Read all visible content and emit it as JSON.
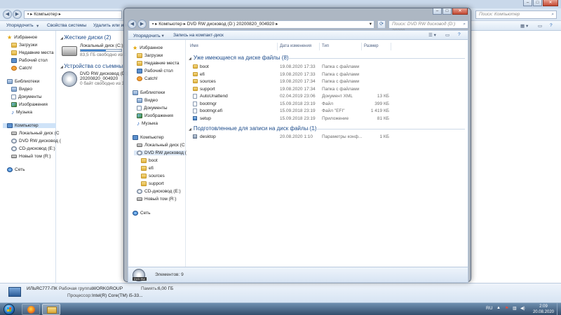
{
  "background_window": {
    "address": "Компьютер",
    "search_placeholder": "Поиск: Компьютер",
    "toolbar": {
      "organize": "Упорядочить",
      "system_properties": "Свойства системы",
      "uninstall": "Удалить или изм"
    },
    "nav": {
      "favorites": "Избранное",
      "downloads": "Загрузки",
      "recent_places": "Недавние места",
      "desktop": "Рабочий стол",
      "catch": "Catch!",
      "libraries": "Библиотеки",
      "video": "Видео",
      "documents": "Документы",
      "pictures": "Изображения",
      "music": "Музыка",
      "computer": "Компьютер",
      "local_disk_c": "Локальный диск (C",
      "dvd_rw": "DVD RW дисковод (",
      "cd_e": "CD-дисковод (E:)",
      "new_volume_r": "Новый том (R:)",
      "network": "Сеть"
    },
    "groups": {
      "hard_disks": "Жесткие диски (2)",
      "removable": "Устройства со съемны"
    },
    "drive_c": {
      "name": "Локальный диск (C:)",
      "free": "83,5 ГБ свободно из 2",
      "used_fraction": 0.62
    },
    "drive_d": {
      "name": "DVD RW дисковод (D:)",
      "label": "20200820_004920",
      "free": "0 байт свободно из 3"
    },
    "details": {
      "pc_name": "ИЛЬЯС777-ПК",
      "workgroup_label": "Рабочая группа:",
      "workgroup_value": "WORKGROUP",
      "memory_label": "Память:",
      "memory_value": "6,00 ГБ",
      "cpu_label": "Процессор:",
      "cpu_value": "Intel(R) Core(TM) i5-33..."
    }
  },
  "dialog": {
    "address_computer": "Компьютер",
    "address_drive": "DVD RW дисковод (D:) 20200820_004920",
    "search_placeholder": "Поиск: DVD RW дисковод (D:) 20200...",
    "toolbar": {
      "organize": "Упорядочить",
      "burn": "Запись на компакт-диск"
    },
    "nav": {
      "favorites": "Избранное",
      "downloads": "Загрузки",
      "recent_places": "Недавние места",
      "desktop": "Рабочий стол",
      "catch": "Catch!",
      "libraries": "Библиотеки",
      "video": "Видео",
      "documents": "Документы",
      "pictures": "Изображения",
      "music": "Музыка",
      "computer": "Компьютер",
      "local_disk_c": "Локальный диск (C",
      "dvd_rw": "DVD RW дисковод (",
      "sub_boot": "boot",
      "sub_efi": "efi",
      "sub_sources": "sources",
      "sub_support": "support",
      "cd_e": "CD-дисковод (E:)",
      "new_volume_r": "Новый том (R:)",
      "network": "Сеть"
    },
    "columns": {
      "name": "Имя",
      "date": "Дата изменения",
      "type": "Тип",
      "size": "Размер"
    },
    "section_existing": "Уже имеющиеся на диске файлы (8)",
    "existing_files": [
      {
        "name": "boot",
        "date": "19.08.2020 17:33",
        "type": "Папка с файлами",
        "size": "",
        "icon": "folder"
      },
      {
        "name": "efi",
        "date": "19.08.2020 17:33",
        "type": "Папка с файлами",
        "size": "",
        "icon": "folder"
      },
      {
        "name": "sources",
        "date": "19.08.2020 17:34",
        "type": "Папка с файлами",
        "size": "",
        "icon": "folder"
      },
      {
        "name": "support",
        "date": "19.08.2020 17:34",
        "type": "Папка с файлами",
        "size": "",
        "icon": "folder"
      },
      {
        "name": "AutoUnattend",
        "date": "02.04.2019 23:06",
        "type": "Документ XML",
        "size": "13 КБ",
        "icon": "file"
      },
      {
        "name": "bootmgr",
        "date": "15.09.2018 23:19",
        "type": "Файл",
        "size": "399 КБ",
        "icon": "file"
      },
      {
        "name": "bootmgr.efi",
        "date": "15.09.2018 23:19",
        "type": "Файл \"EFI\"",
        "size": "1 419 КБ",
        "icon": "file"
      },
      {
        "name": "setup",
        "date": "15.09.2018 23:19",
        "type": "Приложение",
        "size": "81 КБ",
        "icon": "setup"
      }
    ],
    "section_pending": "Подготовленные для записи на диск файлы (1)",
    "pending_files": [
      {
        "name": "desktop",
        "date": "20.08.2020 1:10",
        "type": "Параметры конф...",
        "size": "1 КБ",
        "icon": "desk"
      }
    ],
    "status": {
      "items": "Элементов: 9",
      "dvd_badge": "DVD RW"
    }
  },
  "taskbar": {
    "language": "RU",
    "time": "2:09",
    "date": "20.08.2020"
  },
  "colors": {
    "accent_blue": "#1e4d8c",
    "taskbar": "#344e6c"
  }
}
